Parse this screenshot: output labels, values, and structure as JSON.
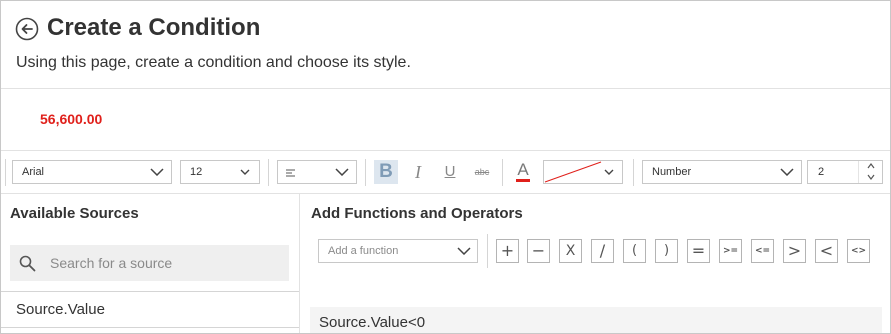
{
  "header": {
    "title": "Create a Condition",
    "subtitle": "Using this page, create a condition and choose its style."
  },
  "preview": {
    "value": "56,600.00",
    "color": "#e0201b"
  },
  "toolbar": {
    "font_family": "Arial",
    "font_size": "12",
    "alignment_icon": "align-left-icon",
    "bold_label": "B",
    "italic_label": "I",
    "underline_label": "U",
    "strikethrough_label": "abc",
    "font_color_label": "A",
    "font_color": "#e0201b",
    "background_color": "none",
    "number_format": "Number",
    "decimal_places": "2"
  },
  "sources": {
    "title": "Available Sources",
    "search_placeholder": "Search for a source",
    "items": [
      "Source.Value"
    ]
  },
  "functions": {
    "title": "Add Functions and Operators",
    "select_placeholder": "Add a function",
    "operators": [
      "+",
      "−",
      "X",
      "/",
      "(",
      ")",
      "=",
      ">=",
      "<=",
      ">",
      "<",
      "<>"
    ]
  },
  "editor": {
    "expression": "Source.Value<0"
  }
}
